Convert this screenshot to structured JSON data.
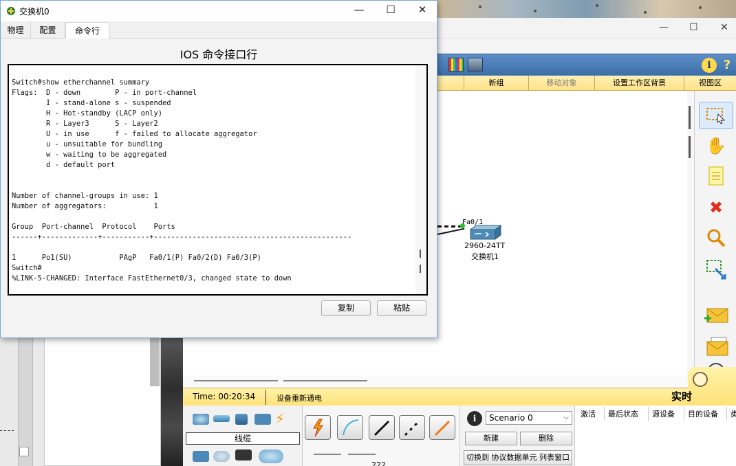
{
  "dialog": {
    "title": "交换机0",
    "tabs": [
      "物理",
      "配置",
      "命令行"
    ],
    "heading": "IOS 命令接口行",
    "terminal_lines": [
      "Switch#show etherchannel summary",
      "Flags:  D - down        P - in port-channel",
      "        I - stand-alone s - suspended",
      "        H - Hot-standby (LACP only)",
      "        R - Layer3      S - Layer2",
      "        U - in use      f - failed to allocate aggregator",
      "        u - unsuitable for bundling",
      "        w - waiting to be aggregated",
      "        d - default port",
      "",
      "",
      "Number of channel-groups in use: 1",
      "Number of aggregators:           1",
      "",
      "Group  Port-channel  Protocol    Ports",
      "------+-------------+-----------+----------------------------------------------",
      "",
      "1      Po1(SU)           PAgP   Fa0/1(P) Fa0/2(D) Fa0/3(P)",
      "Switch#",
      "%LINK-5-CHANGED: Interface FastEthernet0/3, changed state to down"
    ],
    "copy_label": "复制",
    "paste_label": "粘贴"
  },
  "logical_bar": {
    "items": [
      "新组",
      "移动对象",
      "设置工作区背景",
      "视图区"
    ]
  },
  "device": {
    "port_label": "Fa0/1",
    "model": "2960-24TT",
    "name": "交换机1"
  },
  "bottom": {
    "time": "Time: 00:20:34",
    "power_cycle": "设备重新通电",
    "realtime": "实时",
    "connections_label": "线缆",
    "cable_caption": "222"
  },
  "scenario": {
    "selected": "Scenario 0",
    "new_label": "新建",
    "delete_label": "删除",
    "toggle_label": "切换到 协议数据单元 列表窗口"
  },
  "events": {
    "headers": [
      "激活",
      "最后状态",
      "源设备",
      "目的设备",
      "类"
    ]
  },
  "colors": {
    "toolbar": "#3b6ea8",
    "yellow_bar": "#ffe28a",
    "link_dot": "#26c126"
  }
}
